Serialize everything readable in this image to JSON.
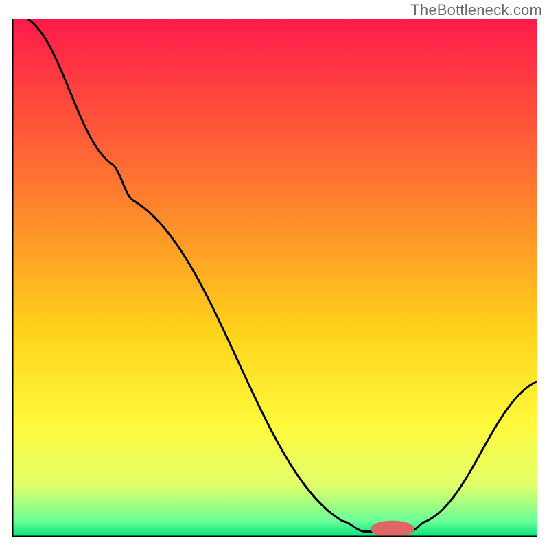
{
  "watermark": "TheBottleneck.com",
  "chart_data": {
    "type": "line",
    "title": "",
    "xlabel": "",
    "ylabel": "",
    "xlim": [
      0,
      100
    ],
    "ylim": [
      0,
      100
    ],
    "gradient_stops": [
      {
        "offset": 0,
        "color": "#ff1a4b"
      },
      {
        "offset": 33,
        "color": "#ff7a2f"
      },
      {
        "offset": 60,
        "color": "#ffd21a"
      },
      {
        "offset": 78,
        "color": "#fff93b"
      },
      {
        "offset": 90,
        "color": "#e2ff6a"
      },
      {
        "offset": 97,
        "color": "#6aff98"
      },
      {
        "offset": 100,
        "color": "#00e577"
      }
    ],
    "series": [
      {
        "name": "bottleneck-curve",
        "color": "#000000",
        "points": [
          {
            "x": 3,
            "y": 100
          },
          {
            "x": 19,
            "y": 72
          },
          {
            "x": 23,
            "y": 65
          },
          {
            "x": 63,
            "y": 3
          },
          {
            "x": 67,
            "y": 1
          },
          {
            "x": 76,
            "y": 1
          },
          {
            "x": 79,
            "y": 3
          },
          {
            "x": 100,
            "y": 30
          }
        ]
      }
    ],
    "marker": {
      "name": "optimal-marker",
      "x": 72.5,
      "y": 1.5,
      "color": "#e06666",
      "rx": 4.2,
      "ry": 1.6
    },
    "axes_visible": true,
    "axes_color": "#000000"
  }
}
